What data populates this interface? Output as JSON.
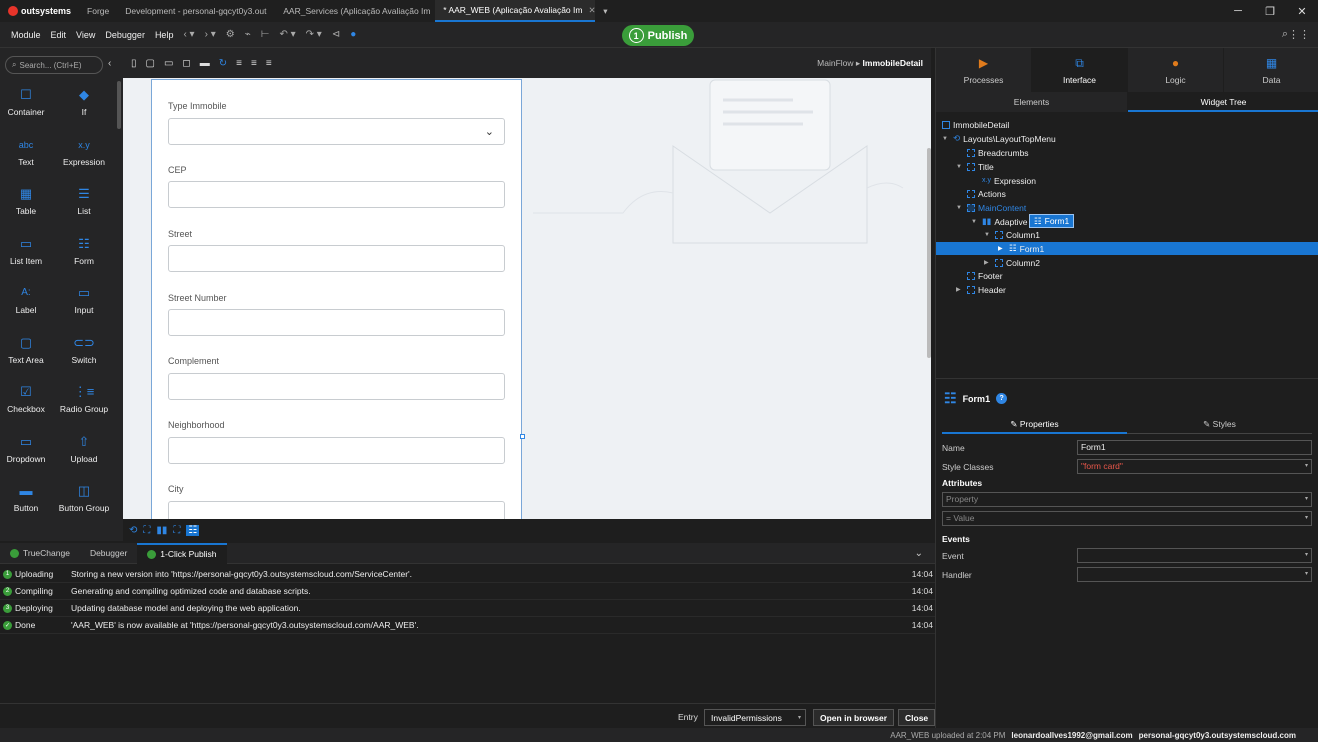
{
  "titlebar": {
    "brand": "outsystems",
    "tabs": [
      {
        "label": "Forge"
      },
      {
        "label": "Development - personal-gqcyt0y3.out"
      },
      {
        "label": "AAR_Services (Aplicação Avaliação Im"
      },
      {
        "label": "* AAR_WEB (Aplicação Avaliação Im"
      }
    ]
  },
  "menubar": {
    "items": [
      "Module",
      "Edit",
      "View",
      "Debugger",
      "Help"
    ],
    "publish_label": "Publish",
    "publish_count": "1"
  },
  "toolbox": {
    "search_placeholder": "Search... (Ctrl+E)",
    "tools": [
      {
        "label": "Container",
        "icon": "container-icon"
      },
      {
        "label": "If",
        "icon": "if-icon"
      },
      {
        "label": "Text",
        "icon": "abc"
      },
      {
        "label": "Expression",
        "icon": "x.y"
      },
      {
        "label": "Table",
        "icon": "table-icon"
      },
      {
        "label": "List",
        "icon": "list-icon"
      },
      {
        "label": "List Item",
        "icon": "list-item-icon"
      },
      {
        "label": "Form",
        "icon": "form-icon"
      },
      {
        "label": "Label",
        "icon": "A:"
      },
      {
        "label": "Input",
        "icon": "input-icon"
      },
      {
        "label": "Text Area",
        "icon": "textarea-icon"
      },
      {
        "label": "Switch",
        "icon": "switch-icon"
      },
      {
        "label": "Checkbox",
        "icon": "checkbox-icon"
      },
      {
        "label": "Radio Group",
        "icon": "radio-icon"
      },
      {
        "label": "Dropdown",
        "icon": "dropdown-icon"
      },
      {
        "label": "Upload",
        "icon": "upload-icon"
      },
      {
        "label": "Button",
        "icon": "button-icon"
      },
      {
        "label": "Button Group",
        "icon": "button-group-icon"
      }
    ]
  },
  "canvas": {
    "breadcrumb_flow": "MainFlow",
    "breadcrumb_screen": "ImmobileDetail",
    "fields": [
      {
        "label": "Type Immobile",
        "type": "select"
      },
      {
        "label": "CEP"
      },
      {
        "label": "Street"
      },
      {
        "label": "Street Number"
      },
      {
        "label": "Complement"
      },
      {
        "label": "Neighborhood"
      },
      {
        "label": "City"
      }
    ]
  },
  "bottom": {
    "tabs": [
      "TrueChange",
      "Debugger",
      "1-Click Publish"
    ],
    "log": [
      {
        "status": "Uploading",
        "message": "Storing a new version into 'https://personal-gqcyt0y3.outsystemscloud.com/ServiceCenter'.",
        "time": "14:04",
        "num": "1"
      },
      {
        "status": "Compiling",
        "message": "Generating and compiling optimized code and database scripts.",
        "time": "14:04",
        "num": "2"
      },
      {
        "status": "Deploying",
        "message": "Updating database model and deploying the web application.",
        "time": "14:04",
        "num": "3"
      },
      {
        "status": "Done",
        "message": "'AAR_WEB' is now available at 'https://personal-gqcyt0y3.outsystemscloud.com/AAR_WEB'.",
        "time": "14:04",
        "num": "✓"
      }
    ],
    "entry_label": "Entry",
    "entry_value": "InvalidPermissions",
    "open_browser": "Open in browser",
    "close": "Close"
  },
  "status": {
    "upload": "AAR_WEB uploaded at 2:04 PM",
    "user": "leonardoallves1992@gmail.com",
    "server": "personal-gqcyt0y3.outsystemscloud.com"
  },
  "right": {
    "tabs": [
      "Processes",
      "Interface",
      "Logic",
      "Data"
    ],
    "subtabs": [
      "Elements",
      "Widget Tree"
    ],
    "tree": [
      {
        "label": "ImmobileDetail",
        "indent": 0
      },
      {
        "label": "Layouts\\LayoutTopMenu",
        "indent": 1
      },
      {
        "label": "Breadcrumbs",
        "indent": 2
      },
      {
        "label": "Title",
        "indent": 2
      },
      {
        "label": "Expression",
        "indent": 3
      },
      {
        "label": "Actions",
        "indent": 2
      },
      {
        "label": "MainContent",
        "indent": 2
      },
      {
        "label": "Adaptive",
        "indent": 3
      },
      {
        "label": "Column1",
        "indent": 4
      },
      {
        "label": "Form1",
        "indent": 5
      },
      {
        "label": "Column2",
        "indent": 4
      },
      {
        "label": "Footer",
        "indent": 2
      },
      {
        "label": "Header",
        "indent": 2
      }
    ],
    "drag_label": "Form1",
    "props": {
      "title": "Form1",
      "tab_properties": "Properties",
      "tab_styles": "Styles",
      "name_label": "Name",
      "name_value": "Form1",
      "style_label": "Style Classes",
      "style_value": "\"form card\"",
      "attributes": "Attributes",
      "property_ph": "Property",
      "value_ph": "= Value",
      "events": "Events",
      "event_label": "Event",
      "handler_label": "Handler"
    }
  }
}
